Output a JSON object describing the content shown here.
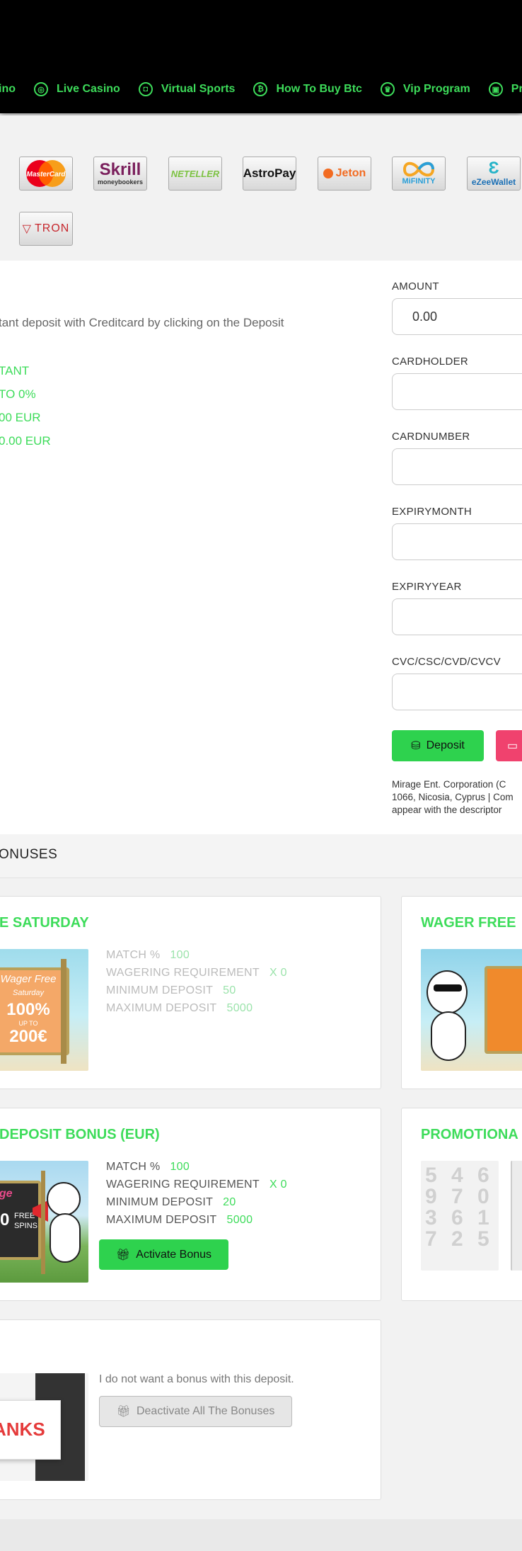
{
  "nav": {
    "items": [
      {
        "icon": "casino-chip-icon",
        "label": "ino"
      },
      {
        "icon": "live-casino-chip-icon",
        "label": "Live Casino"
      },
      {
        "icon": "gamepad-icon",
        "label": "Virtual Sports"
      },
      {
        "icon": "bitcoin-icon",
        "label": "How To Buy Btc"
      },
      {
        "icon": "crown-icon",
        "label": "Vip Program"
      },
      {
        "icon": "gift-icon",
        "label": "Promo"
      }
    ]
  },
  "payment_methods": [
    {
      "name": "MasterCard",
      "label": "MasterCard"
    },
    {
      "name": "Skrill",
      "label": "Skrill",
      "sub": "moneybookers"
    },
    {
      "name": "Neteller",
      "label": "NETELLER"
    },
    {
      "name": "AstroPay",
      "label": "AstroPay"
    },
    {
      "name": "Jeton",
      "label": "Jeton"
    },
    {
      "name": "MiFinity",
      "label": "MiFINITY"
    },
    {
      "name": "eZeeWallet",
      "label": "eZeeWallet"
    },
    {
      "name": "Tron",
      "label": "TRON"
    }
  ],
  "deposit": {
    "description": "tant deposit with Creditcard by clicking on the Deposit",
    "info": [
      "TANT",
      "TO 0%",
      "00 EUR",
      "0.00 EUR"
    ],
    "fields": {
      "amount_label": "AMOUNT",
      "amount_value": "0.00",
      "cardholder_label": "CARDHOLDER",
      "cardnumber_label": "CARDNUMBER",
      "expirymonth_label": "EXPIRYMONTH",
      "expiryyear_label": "EXPIRYYEAR",
      "cvc_label": "CVC/CSC/CVD/CVCV"
    },
    "deposit_button": "Deposit",
    "legal": [
      "Mirage Ent. Corporation (C",
      "1066, Nicosia, Cyprus | Com",
      "appear with the descriptor"
    ]
  },
  "bonuses": {
    "header": "ONUSES",
    "cards": [
      {
        "title": "E SATURDAY",
        "thumb_text": [
          "Wager Free",
          "Saturday",
          "100%",
          "UP TO",
          "200€"
        ],
        "rows": [
          {
            "k": "MATCH %",
            "v": "100"
          },
          {
            "k": "WAGERING REQUIREMENT",
            "v": "X 0"
          },
          {
            "k": "MINIMUM DEPOSIT",
            "v": "50"
          },
          {
            "k": "MAXIMUM DEPOSIT",
            "v": "5000"
          }
        ]
      },
      {
        "title": "WAGER FREE"
      },
      {
        "title": "DEPOSIT BONUS (EUR)",
        "thumb_text": [
          "age",
          "0",
          "FREE",
          "SPINS"
        ],
        "rows": [
          {
            "k": "MATCH %",
            "v": "100"
          },
          {
            "k": "WAGERING REQUIREMENT",
            "v": "X 0"
          },
          {
            "k": "MINIMUM DEPOSIT",
            "v": "20"
          },
          {
            "k": "MAXIMUM DEPOSIT",
            "v": "5000"
          }
        ],
        "button": "Activate Bonus"
      },
      {
        "title": "PROMOTIONA"
      },
      {
        "thumb_text": "ANKS",
        "text": "I do not want a bonus with this deposit.",
        "button": "Deactivate All The Bonuses"
      }
    ]
  }
}
